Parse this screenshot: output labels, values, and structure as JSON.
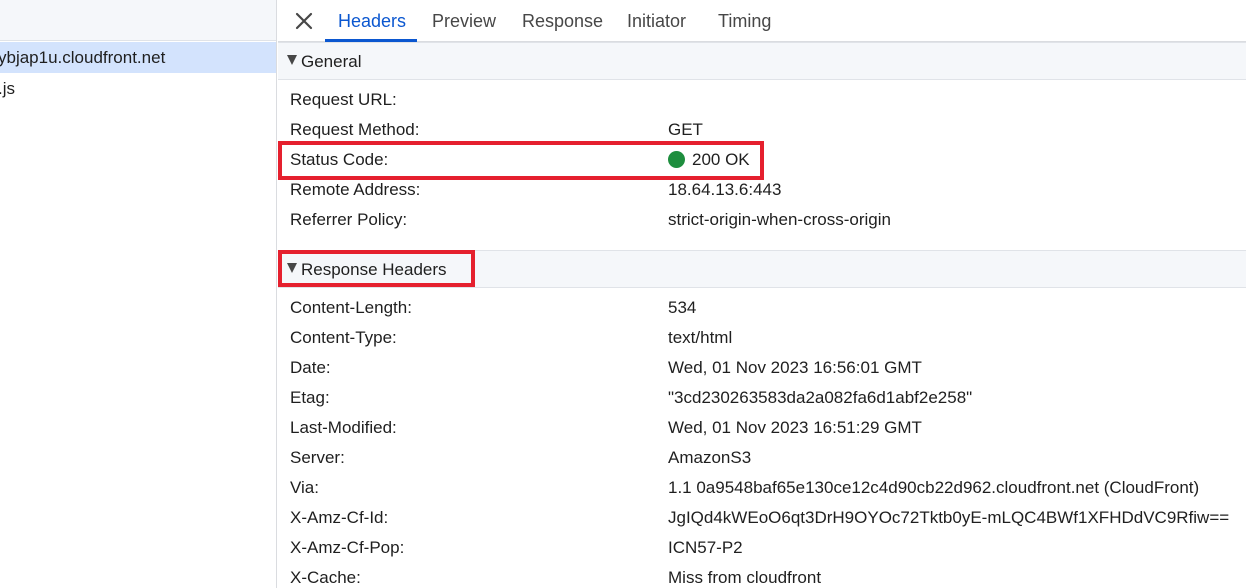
{
  "requests": [
    {
      "label": "ybjap1u.cloudfront.net",
      "selected": true
    },
    {
      "label": ".js",
      "selected": false
    }
  ],
  "tabs": [
    "Headers",
    "Preview",
    "Response",
    "Initiator",
    "Timing"
  ],
  "active_tab": "Headers",
  "general": {
    "title": "General",
    "rows": [
      {
        "key": "Request URL:",
        "value": ""
      },
      {
        "key": "Request Method:",
        "value": "GET"
      },
      {
        "key": "Status Code:",
        "value": "200 OK"
      },
      {
        "key": "Remote Address:",
        "value": "18.64.13.6:443"
      },
      {
        "key": "Referrer Policy:",
        "value": "strict-origin-when-cross-origin"
      }
    ]
  },
  "response_headers": {
    "title": "Response Headers",
    "rows": [
      {
        "key": "Content-Length:",
        "value": "534"
      },
      {
        "key": "Content-Type:",
        "value": "text/html"
      },
      {
        "key": "Date:",
        "value": "Wed, 01 Nov 2023 16:56:01 GMT"
      },
      {
        "key": "Etag:",
        "value": "\"3cd230263583da2a082fa6d1abf2e258\""
      },
      {
        "key": "Last-Modified:",
        "value": "Wed, 01 Nov 2023 16:51:29 GMT"
      },
      {
        "key": "Server:",
        "value": "AmazonS3"
      },
      {
        "key": "Via:",
        "value": "1.1 0a9548baf65e130ce12c4d90cb22d962.cloudfront.net (CloudFront)"
      },
      {
        "key": "X-Amz-Cf-Id:",
        "value": "JgIQd4kWEoO6qt3DrH9OYOc72Tktb0yE-mLQC4BWf1XFHDdVC9Rfiw=="
      },
      {
        "key": "X-Amz-Cf-Pop:",
        "value": "ICN57-P2"
      },
      {
        "key": "X-Cache:",
        "value": "Miss from cloudfront"
      }
    ]
  },
  "colors": {
    "accent": "#0b57d0",
    "status_ok": "#1e8e3e",
    "highlight": "#e5202e",
    "selected_row": "#d3e3fd"
  },
  "icons": {
    "close": "close-icon",
    "expand": "triangle-down-icon",
    "status": "status-dot-icon"
  }
}
